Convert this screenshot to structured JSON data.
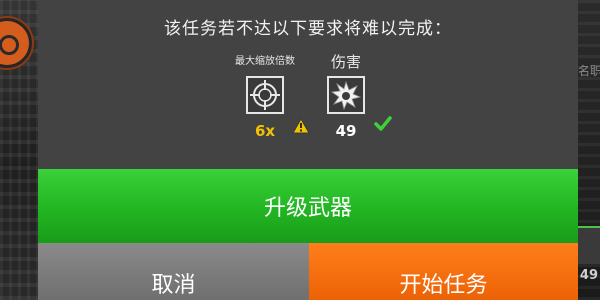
{
  "background": {
    "right_text": "名职",
    "right_number": "49"
  },
  "dialog": {
    "title": "该任务若不达以下要求将难以完成：",
    "requirements": [
      {
        "label": "最大缩放倍数",
        "icon": "scope-icon",
        "status": "warning",
        "value": "6x"
      },
      {
        "label": "伤害",
        "icon": "explosion-icon",
        "status": "met",
        "value": "49"
      }
    ]
  },
  "buttons": {
    "upgrade": "升级武器",
    "cancel": "取消",
    "start": "开始任务"
  },
  "colors": {
    "dialog_bg": "#434343",
    "upgrade_green": "#2bc12b",
    "cancel_gray": "#7d7d7d",
    "start_orange": "#f56f0e",
    "warning_yellow": "#f2c400",
    "check_green": "#3dd13d"
  }
}
